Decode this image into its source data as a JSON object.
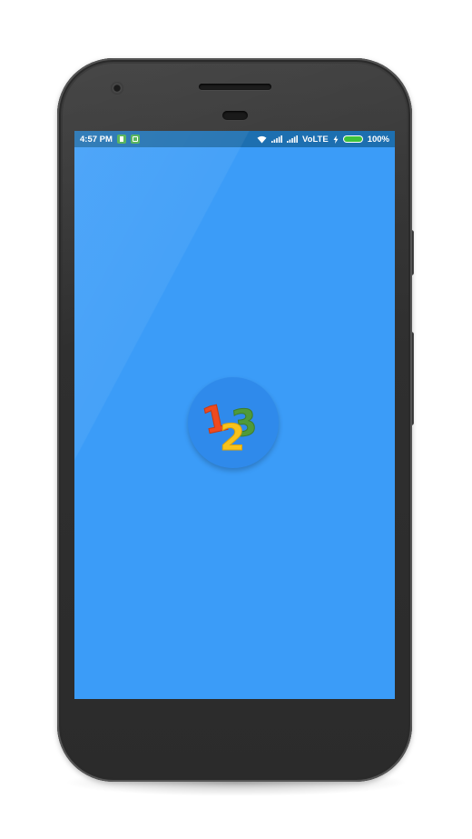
{
  "status_bar": {
    "time": "4:57 PM",
    "network_label": "VoLTE",
    "battery_percent_text": "100%",
    "battery_level": 1.0,
    "notification_icons": [
      "app-notification-icon",
      "app-notification-icon"
    ],
    "icons": [
      "wifi-icon",
      "signal-icon",
      "signal-icon",
      "charging-icon",
      "battery-icon"
    ]
  },
  "splash": {
    "logo_icon": "numbers-123-logo-icon",
    "logo_digits": [
      "1",
      "2",
      "3"
    ],
    "background_color": "#3b9cf8",
    "status_bar_color": "#1d6fb0"
  },
  "device": {
    "frame": "smartphone",
    "frame_color": "#333333"
  }
}
